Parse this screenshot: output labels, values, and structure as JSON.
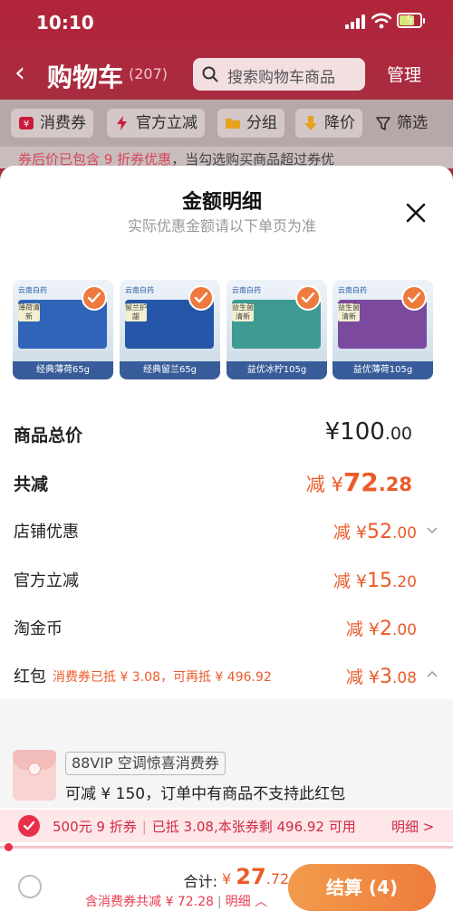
{
  "status": {
    "time": "10:10"
  },
  "nav": {
    "title": "购物车",
    "count": "(207)",
    "search_placeholder": "搜索购物车商品",
    "manage": "管理"
  },
  "filters": [
    {
      "label": "消费券",
      "icon": "coupon-icon"
    },
    {
      "label": "官方立减",
      "icon": "lightning-icon"
    },
    {
      "label": "分组",
      "icon": "folder-icon"
    },
    {
      "label": "降价",
      "icon": "down-arrow-icon"
    },
    {
      "label": "筛选",
      "icon": "funnel-icon"
    }
  ],
  "notice": {
    "highlight": "券后价已包含 9 折券优惠",
    "rest": "，当勾选购买商品超过券优"
  },
  "sheet": {
    "title": "金额明细",
    "subtitle": "实际优惠金额请以下单页为准"
  },
  "products": [
    {
      "caption": "经典薄荷65g",
      "box_color": "#2f64b8",
      "tag": "薄荷清新"
    },
    {
      "caption": "经典留兰65g",
      "box_color": "#2556a8",
      "tag": "留兰护龈"
    },
    {
      "caption": "益优冰柠105g",
      "box_color": "#3e9a93",
      "tag": "益生菌清新"
    },
    {
      "caption": "益优薄荷105g",
      "box_color": "#7b4a9e",
      "tag": "益生菌清新"
    }
  ],
  "brand": "云南白药",
  "summary": {
    "total_label": "商品总价",
    "total_int": "¥100",
    "total_dec": ".00",
    "cut_label": "共减",
    "cut_prefix": "减 ¥",
    "cut_int": "72",
    "cut_dec": ".28",
    "items": [
      {
        "label": "店铺优惠",
        "prefix": "减 ¥",
        "int": "52",
        "dec": ".00"
      },
      {
        "label": "官方立减",
        "prefix": "减 ¥",
        "int": "15",
        "dec": ".20"
      },
      {
        "label": "淘金币",
        "prefix": "减 ¥",
        "int": "2",
        "dec": ".00"
      },
      {
        "label": "红包",
        "prefix": "减 ¥",
        "int": "3",
        "dec": ".08"
      }
    ],
    "hongbao_note": "消费券已抵 ¥ 3.08，可再抵 ¥ 496.92"
  },
  "vip": {
    "tag": "88VIP 空调惊喜消费券",
    "desc": "可减 ¥ 150，订单中有商品不支持此红包"
  },
  "coupon_bar": {
    "left": "500元 9 折券",
    "right": "已抵 3.08,本张券剩 496.92 可用",
    "more": "明细 >"
  },
  "checkout": {
    "sum_label": "合计:",
    "sum_prefix": "¥",
    "sum_int": "27",
    "sum_dec": ".72",
    "sub_text": "含消费券共减 ¥ 72.28",
    "sub_more": "明细",
    "pay_label": "结算 (4)"
  },
  "colors": {
    "accent": "#ea5b2a",
    "brand_red": "#b2243a",
    "coupon_red": "#e8304a"
  }
}
